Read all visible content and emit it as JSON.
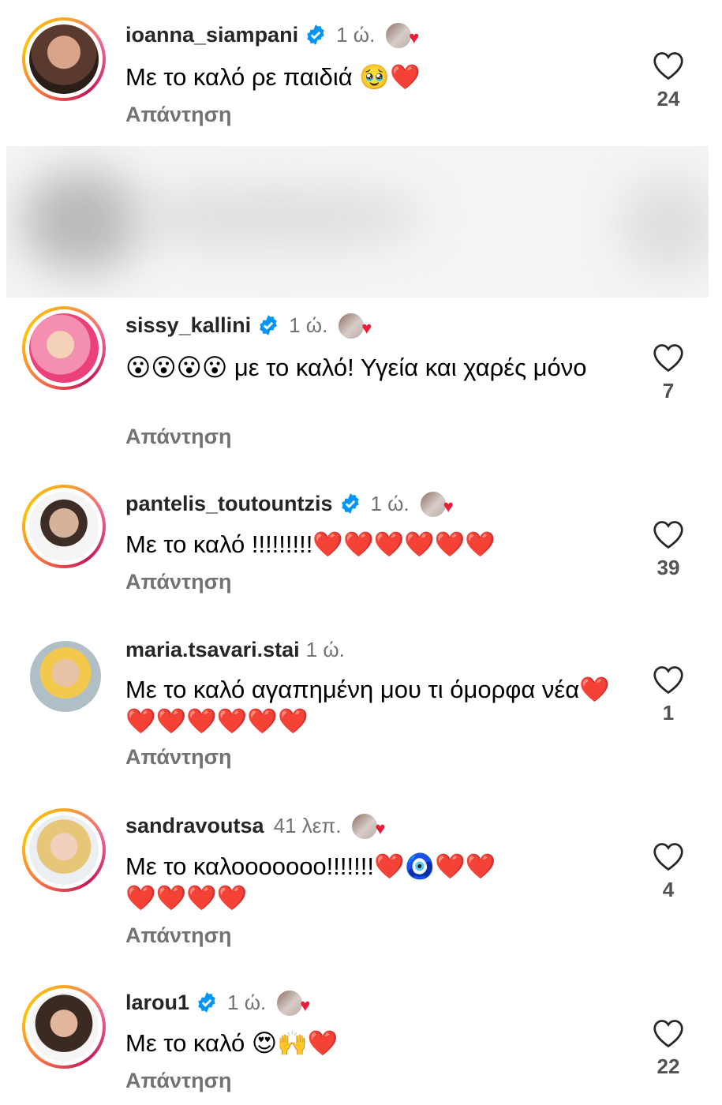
{
  "comments": [
    {
      "username": "ioanna_siampani",
      "verified": true,
      "time": "1 ώ.",
      "liked_by_author": true,
      "text": "Με το καλό ρε παιδιά 🥹❤️",
      "reply": "Απάντηση",
      "likes": "24"
    },
    {
      "username": "sissy_kallini",
      "verified": true,
      "time": "1 ώ.",
      "liked_by_author": true,
      "text": "😮😮😮😮 με το καλό! Υγεία και χαρές μόνο",
      "reply": "Απάντηση",
      "likes": "7"
    },
    {
      "username": "pantelis_toutountzis",
      "verified": true,
      "time": "1 ώ.",
      "liked_by_author": true,
      "text": "Με το καλό !!!!!!!!!❤️❤️❤️❤️❤️❤️",
      "reply": "Απάντηση",
      "likes": "39"
    },
    {
      "username": "maria.tsavari.stai",
      "verified": false,
      "time": "1 ώ.",
      "liked_by_author": false,
      "text": "Με το καλό αγαπημένη μου τι όμορφα νέα❤️❤️❤️❤️❤️❤️❤️",
      "reply": "Απάντηση",
      "likes": "1"
    },
    {
      "username": "sandravoutsa",
      "verified": false,
      "time": "41 λεπ.",
      "liked_by_author": true,
      "text": "Με το καλοοοοοοο!!!!!!!❤️🧿❤️❤️❤️❤️❤️❤️",
      "reply": "Απάντηση",
      "likes": "4"
    },
    {
      "username": "larou1",
      "verified": true,
      "time": "1 ώ.",
      "liked_by_author": true,
      "text": "Με το καλό 😍🙌❤️",
      "reply": "Απάντηση",
      "likes": "22"
    }
  ],
  "icons": {
    "like": "heart-outline-icon",
    "verified": "verified-badge-icon",
    "author_like": "author-liked-heart-icon"
  },
  "colors": {
    "verified": "#0095f6",
    "ring_start": "#f9a825",
    "ring_end": "#c2185b",
    "muted": "#737373",
    "author_heart": "#ed1c35"
  }
}
